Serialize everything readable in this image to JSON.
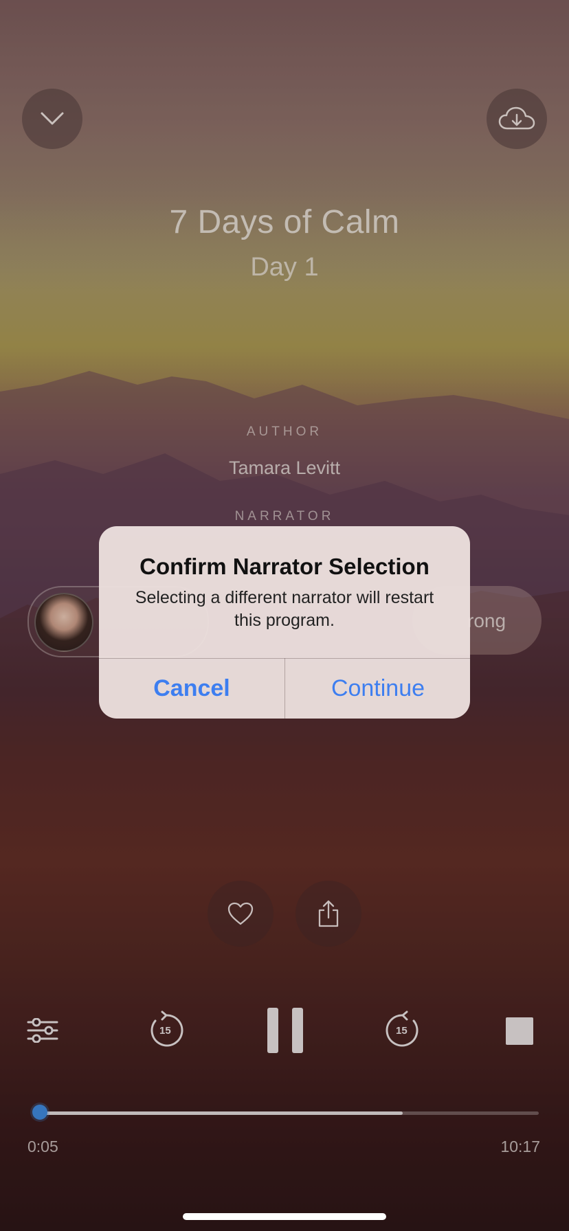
{
  "header": {
    "collapse_icon": "chevron-down-icon",
    "download_icon": "cloud-download-icon"
  },
  "program": {
    "title": "7 Days of Calm",
    "subtitle": "Day 1"
  },
  "credits": {
    "author_label": "AUTHOR",
    "author_name": "Tamara Levitt",
    "narrator_label": "NARRATOR"
  },
  "narrators": {
    "right_chip_partial_label": "rong"
  },
  "alert": {
    "title": "Confirm Narrator Selection",
    "message": "Selecting a different narrator will restart this program.",
    "cancel_label": "Cancel",
    "continue_label": "Continue"
  },
  "actions": {
    "favorite_icon": "heart-icon",
    "share_icon": "share-icon"
  },
  "playback": {
    "settings_icon": "sliders-icon",
    "rewind_seconds": "15",
    "forward_seconds": "15",
    "state": "playing",
    "elapsed": "0:05",
    "total": "10:17",
    "buffered_fraction": 0.73,
    "played_fraction": 0.008
  },
  "colors": {
    "accent": "#3d7ef0",
    "progress_knob": "#3e86d8"
  }
}
